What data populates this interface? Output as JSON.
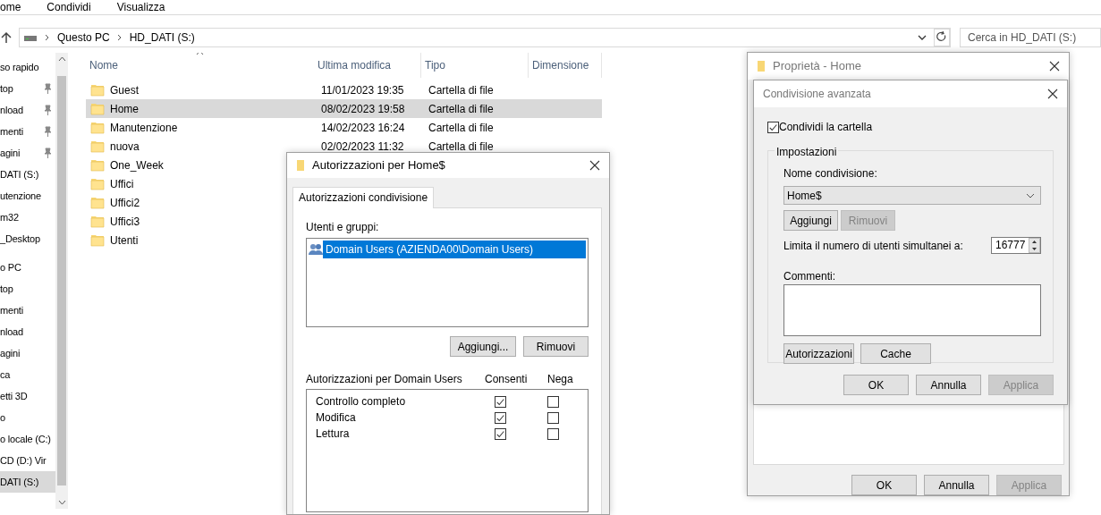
{
  "ribbon_tabs": [
    "ome",
    "Condividi",
    "Visualizza"
  ],
  "address_bar": {
    "path": [
      "Questo PC",
      "HD_DATI (S:)"
    ]
  },
  "search": {
    "placeholder": "Cerca in HD_DATI (S:)"
  },
  "sidebar": {
    "sections": [
      {
        "items": [
          {
            "label": "so rapido",
            "pinned": false,
            "selected": false
          },
          {
            "label": "top",
            "pinned": true,
            "selected": false
          },
          {
            "label": "nload",
            "pinned": true,
            "selected": false
          },
          {
            "label": "menti",
            "pinned": true,
            "selected": false
          },
          {
            "label": "agini",
            "pinned": true,
            "selected": false
          },
          {
            "label": "DATI (S:)",
            "pinned": false,
            "selected": false
          },
          {
            "label": "utenzione",
            "pinned": false,
            "selected": false
          },
          {
            "label": "m32",
            "pinned": false,
            "selected": false
          },
          {
            "label": "_Desktop",
            "pinned": false,
            "selected": false
          }
        ]
      },
      {
        "items": [
          {
            "label": "o PC",
            "pinned": false,
            "selected": false
          },
          {
            "label": "top",
            "pinned": false,
            "selected": false
          },
          {
            "label": "menti",
            "pinned": false,
            "selected": false
          },
          {
            "label": "nload",
            "pinned": false,
            "selected": false
          },
          {
            "label": "agini",
            "pinned": false,
            "selected": false
          },
          {
            "label": "ca",
            "pinned": false,
            "selected": false
          },
          {
            "label": "etti 3D",
            "pinned": false,
            "selected": false
          },
          {
            "label": "o",
            "pinned": false,
            "selected": false
          },
          {
            "label": "o locale (C:)",
            "pinned": false,
            "selected": false
          },
          {
            "label": "CD (D:) Vir",
            "pinned": false,
            "selected": false
          },
          {
            "label": "DATI (S:)",
            "pinned": false,
            "selected": true
          }
        ]
      }
    ]
  },
  "file_list": {
    "columns": [
      "Nome",
      "Ultima modifica",
      "Tipo",
      "Dimensione"
    ],
    "rows": [
      {
        "name": "Guest",
        "modified": "11/01/2023 19:35",
        "type": "Cartella di file",
        "selected": false
      },
      {
        "name": "Home",
        "modified": "08/02/2023 19:58",
        "type": "Cartella di file",
        "selected": true
      },
      {
        "name": "Manutenzione",
        "modified": "14/02/2023 16:24",
        "type": "Cartella di file",
        "selected": false
      },
      {
        "name": "nuova",
        "modified": "02/02/2023 11:32",
        "type": "Cartella di file",
        "selected": false
      },
      {
        "name": "One_Week",
        "selected": false
      },
      {
        "name": "Uffici",
        "selected": false
      },
      {
        "name": "Uffici2",
        "selected": false
      },
      {
        "name": "Uffici3",
        "selected": false
      },
      {
        "name": "Utenti",
        "selected": false
      }
    ]
  },
  "permissions_dialog": {
    "title": "Autorizzazioni per Home$",
    "tab": {
      "label": "Autorizzazioni condivisione",
      "selected": true
    },
    "users_label": "Utenti e gruppi:",
    "users": [
      {
        "name": "Domain Users (AZIENDA00\\Domain Users)",
        "selected": true
      }
    ],
    "buttons": [
      "Aggiungi...",
      "Rimuovi"
    ],
    "permissions_label": "Autorizzazioni per Domain Users",
    "allow_label": "Consenti",
    "deny_label": "Nega",
    "permissions": [
      {
        "name": "Controllo completo",
        "allow": true,
        "deny": false
      },
      {
        "name": "Modifica",
        "allow": true,
        "deny": false
      },
      {
        "name": "Lettura",
        "allow": true,
        "deny": false
      }
    ]
  },
  "properties_dialog": {
    "title": "Proprietà - Home",
    "buttons": [
      {
        "label": "OK",
        "disabled": false
      },
      {
        "label": "Annulla",
        "disabled": false
      },
      {
        "label": "Applica",
        "disabled": true
      }
    ]
  },
  "advanced_sharing": {
    "title": "Condivisione avanzata",
    "share_checkbox": {
      "label": "Condividi la cartella",
      "checked": true
    },
    "group_label": "Impostazioni",
    "share_name_label": "Nome condivisione:",
    "share_name": "Home$",
    "name_buttons": [
      {
        "label": "Aggiungi",
        "disabled": false
      },
      {
        "label": "Rimuovi",
        "disabled": true
      }
    ],
    "limit_label": "Limita il numero di utenti simultanei a:",
    "limit_value": "16777",
    "comments_label": "Commenti:",
    "action_buttons": [
      "Autorizzazioni",
      "Cache"
    ],
    "buttons": [
      {
        "label": "OK",
        "disabled": false
      },
      {
        "label": "Annulla",
        "disabled": false
      },
      {
        "label": "Applica",
        "disabled": true
      }
    ]
  }
}
